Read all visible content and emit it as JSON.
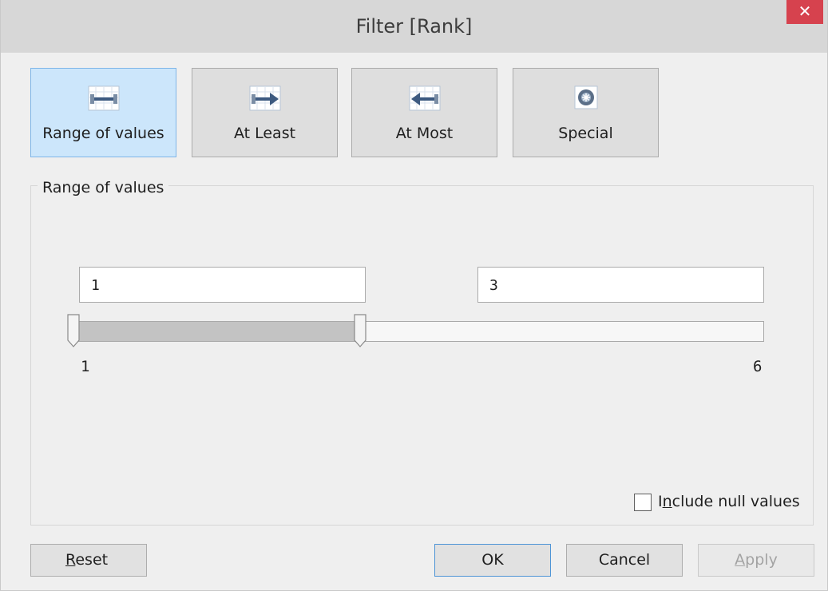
{
  "window": {
    "title": "Filter [Rank]",
    "close_glyph": "✕"
  },
  "modes": [
    {
      "label": "Range of values",
      "icon": "range-of-values-icon",
      "selected": true
    },
    {
      "label": "At Least",
      "icon": "at-least-icon",
      "selected": false
    },
    {
      "label": "At Most",
      "icon": "at-most-icon",
      "selected": false
    },
    {
      "label": "Special",
      "icon": "special-icon",
      "selected": false
    }
  ],
  "range": {
    "group_title": "Range of values",
    "min_value": "1",
    "max_value": "3",
    "scale_min": "1",
    "scale_max": "6",
    "include_null": {
      "label_pre": "I",
      "label_accel": "n",
      "label_post": "clude null values",
      "checked": false
    }
  },
  "buttons": {
    "reset_accel": "R",
    "reset_rest": "eset",
    "ok": "OK",
    "cancel": "Cancel",
    "apply_accel": "A",
    "apply_rest": "pply"
  },
  "colors": {
    "selected_mode_bg": "#cce6fb",
    "close_button": "#d6424e",
    "default_button_border": "#4f95d6"
  }
}
